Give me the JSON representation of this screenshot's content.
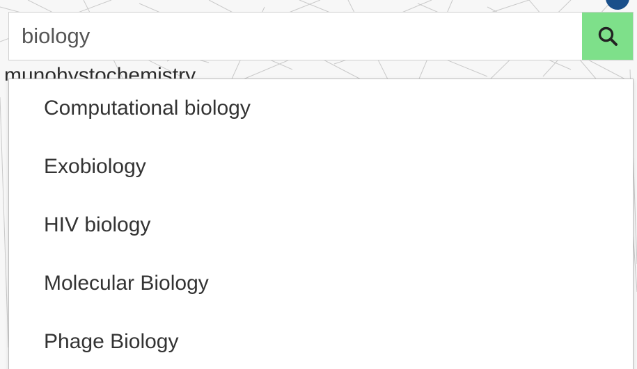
{
  "search": {
    "value": "biology",
    "button_icon": "search-icon"
  },
  "background": {
    "partial_text": "munohystochemistry"
  },
  "suggestions": [
    {
      "label": "Computational biology"
    },
    {
      "label": "Exobiology"
    },
    {
      "label": "HIV biology"
    },
    {
      "label": "Molecular Biology"
    },
    {
      "label": "Phage Biology"
    }
  ],
  "colors": {
    "search_button": "#7ee08a",
    "corner_dot": "#1a4f8a",
    "text": "#333333"
  }
}
